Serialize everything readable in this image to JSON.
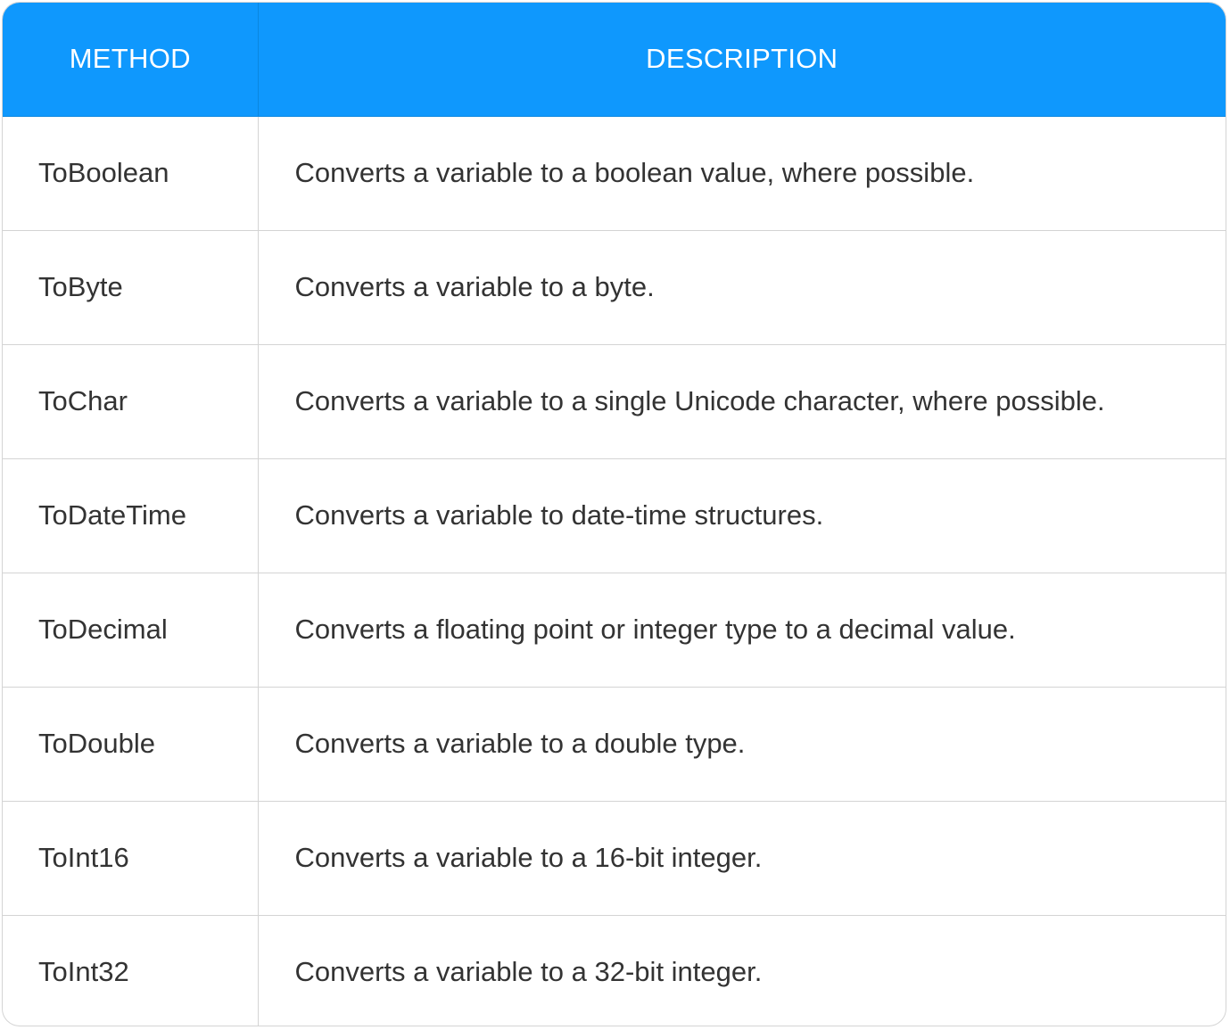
{
  "table": {
    "headers": {
      "method": "METHOD",
      "description": "DESCRIPTION"
    },
    "rows": [
      {
        "method": "ToBoolean",
        "description": "Converts a variable to a boolean value, where possible."
      },
      {
        "method": "ToByte",
        "description": "Converts a variable to a byte."
      },
      {
        "method": "ToChar",
        "description": "Converts a variable to a single Unicode character, where possible."
      },
      {
        "method": "ToDateTime",
        "description": "Converts a variable to date-time structures."
      },
      {
        "method": "ToDecimal",
        "description": "Converts a floating point or integer type to a decimal value."
      },
      {
        "method": "ToDouble",
        "description": "Converts a variable to a double type."
      },
      {
        "method": "ToInt16",
        "description": "Converts a variable to a 16-bit integer."
      },
      {
        "method": "ToInt32",
        "description": "Converts a variable to a 32-bit integer."
      }
    ]
  },
  "colors": {
    "header_background": "#0f98fd",
    "header_text": "#ffffff",
    "body_text": "#333333",
    "grid_lines": "#d4d4d4"
  }
}
